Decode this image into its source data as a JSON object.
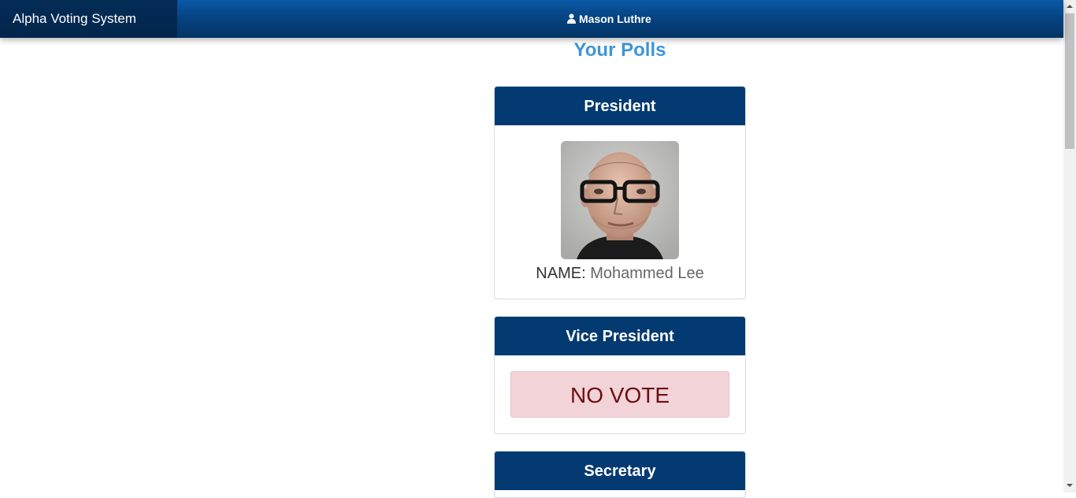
{
  "header": {
    "brand": "Alpha Voting System",
    "user_name": "Mason Luthre",
    "user_icon": "user-icon"
  },
  "main": {
    "title": "Your Polls",
    "polls": [
      {
        "position": "President",
        "candidate": {
          "label": "NAME:",
          "name": "Mohammed Lee",
          "photo": "candidate-photo"
        }
      },
      {
        "position": "Vice President",
        "status": "NO VOTE"
      },
      {
        "position": "Secretary"
      }
    ]
  },
  "colors": {
    "navbar": "#05427f",
    "brand_bg": "#02264b",
    "card_header": "#033a72",
    "title": "#3d96d8",
    "novote_bg": "#f2d3d7",
    "novote_text": "#6b0f13"
  }
}
